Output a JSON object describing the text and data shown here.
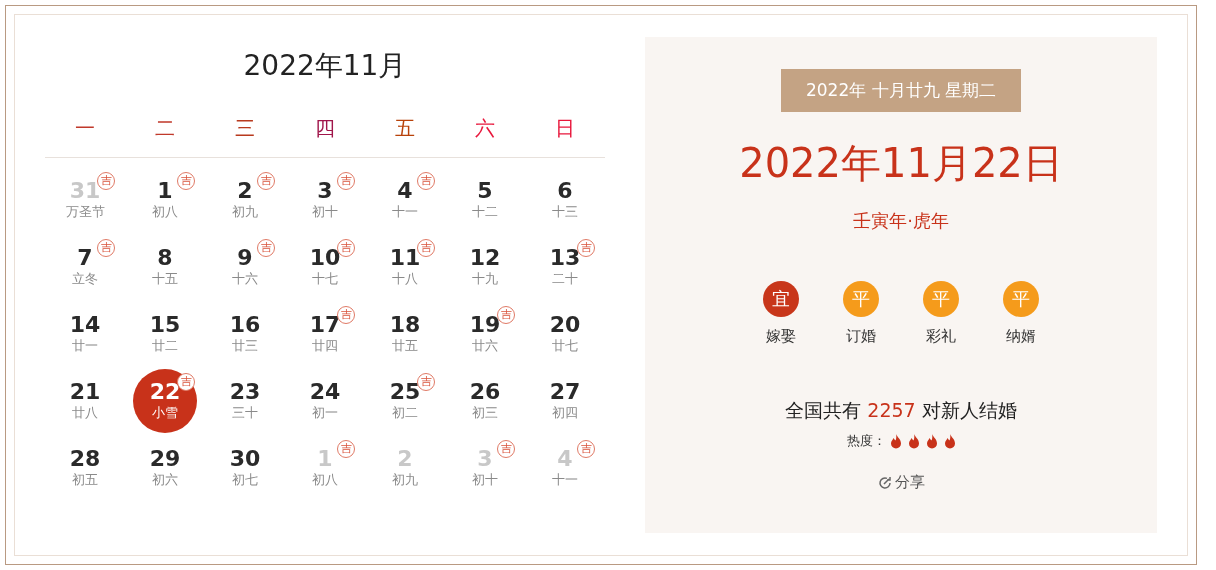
{
  "calendar": {
    "title": "2022年11月",
    "weekdays": [
      {
        "label": "一",
        "color": "#c0392b"
      },
      {
        "label": "二",
        "color": "#c0392b"
      },
      {
        "label": "三",
        "color": "#b83a1e"
      },
      {
        "label": "四",
        "color": "#a0154a"
      },
      {
        "label": "五",
        "color": "#b8420a"
      },
      {
        "label": "六",
        "color": "#e8173c"
      },
      {
        "label": "日",
        "color": "#e8173c"
      }
    ],
    "days": [
      {
        "day": "31",
        "lunar": "万圣节",
        "badge": "吉",
        "other_month": true,
        "selected": false
      },
      {
        "day": "1",
        "lunar": "初八",
        "badge": "吉",
        "other_month": false,
        "selected": false
      },
      {
        "day": "2",
        "lunar": "初九",
        "badge": "吉",
        "other_month": false,
        "selected": false
      },
      {
        "day": "3",
        "lunar": "初十",
        "badge": "吉",
        "other_month": false,
        "selected": false
      },
      {
        "day": "4",
        "lunar": "十一",
        "badge": "吉",
        "other_month": false,
        "selected": false
      },
      {
        "day": "5",
        "lunar": "十二",
        "other_month": false,
        "selected": false
      },
      {
        "day": "6",
        "lunar": "十三",
        "other_month": false,
        "selected": false
      },
      {
        "day": "7",
        "lunar": "立冬",
        "badge": "吉",
        "other_month": false,
        "selected": false
      },
      {
        "day": "8",
        "lunar": "十五",
        "other_month": false,
        "selected": false
      },
      {
        "day": "9",
        "lunar": "十六",
        "badge": "吉",
        "other_month": false,
        "selected": false
      },
      {
        "day": "10",
        "lunar": "十七",
        "badge": "吉",
        "other_month": false,
        "selected": false
      },
      {
        "day": "11",
        "lunar": "十八",
        "badge": "吉",
        "other_month": false,
        "selected": false
      },
      {
        "day": "12",
        "lunar": "十九",
        "other_month": false,
        "selected": false
      },
      {
        "day": "13",
        "lunar": "二十",
        "badge": "吉",
        "other_month": false,
        "selected": false
      },
      {
        "day": "14",
        "lunar": "廿一",
        "other_month": false,
        "selected": false
      },
      {
        "day": "15",
        "lunar": "廿二",
        "other_month": false,
        "selected": false
      },
      {
        "day": "16",
        "lunar": "廿三",
        "other_month": false,
        "selected": false
      },
      {
        "day": "17",
        "lunar": "廿四",
        "badge": "吉",
        "other_month": false,
        "selected": false
      },
      {
        "day": "18",
        "lunar": "廿五",
        "other_month": false,
        "selected": false
      },
      {
        "day": "19",
        "lunar": "廿六",
        "badge": "吉",
        "other_month": false,
        "selected": false
      },
      {
        "day": "20",
        "lunar": "廿七",
        "other_month": false,
        "selected": false
      },
      {
        "day": "21",
        "lunar": "廿八",
        "other_month": false,
        "selected": false
      },
      {
        "day": "22",
        "lunar": "小雪",
        "badge": "吉",
        "other_month": false,
        "selected": true
      },
      {
        "day": "23",
        "lunar": "三十",
        "other_month": false,
        "selected": false
      },
      {
        "day": "24",
        "lunar": "初一",
        "other_month": false,
        "selected": false
      },
      {
        "day": "25",
        "lunar": "初二",
        "badge": "吉",
        "other_month": false,
        "selected": false
      },
      {
        "day": "26",
        "lunar": "初三",
        "other_month": false,
        "selected": false
      },
      {
        "day": "27",
        "lunar": "初四",
        "other_month": false,
        "selected": false
      },
      {
        "day": "28",
        "lunar": "初五",
        "other_month": false,
        "selected": false
      },
      {
        "day": "29",
        "lunar": "初六",
        "other_month": false,
        "selected": false
      },
      {
        "day": "30",
        "lunar": "初七",
        "other_month": false,
        "selected": false
      },
      {
        "day": "1",
        "lunar": "初八",
        "badge": "吉",
        "other_month": true,
        "selected": false
      },
      {
        "day": "2",
        "lunar": "初九",
        "other_month": true,
        "selected": false
      },
      {
        "day": "3",
        "lunar": "初十",
        "badge": "吉",
        "other_month": true,
        "selected": false
      },
      {
        "day": "4",
        "lunar": "十一",
        "badge": "吉",
        "other_month": true,
        "selected": false
      }
    ]
  },
  "detail": {
    "lunar_date": "2022年 十月廿九 星期二",
    "date": "2022年11月22日",
    "year_name": "壬寅年·虎年",
    "activities": [
      {
        "mark": "宜",
        "label": "嫁娶",
        "color": "#c8361a"
      },
      {
        "mark": "平",
        "label": "订婚",
        "color": "#f59b1b"
      },
      {
        "mark": "平",
        "label": "彩礼",
        "color": "#f59b1b"
      },
      {
        "mark": "平",
        "label": "纳婿",
        "color": "#f59b1b"
      }
    ],
    "count_before": "全国共有",
    "count": "2257",
    "count_after": "对新人结婚",
    "heat_label": "热度：",
    "heat": {
      "stars": 4
    },
    "share": "分享"
  }
}
